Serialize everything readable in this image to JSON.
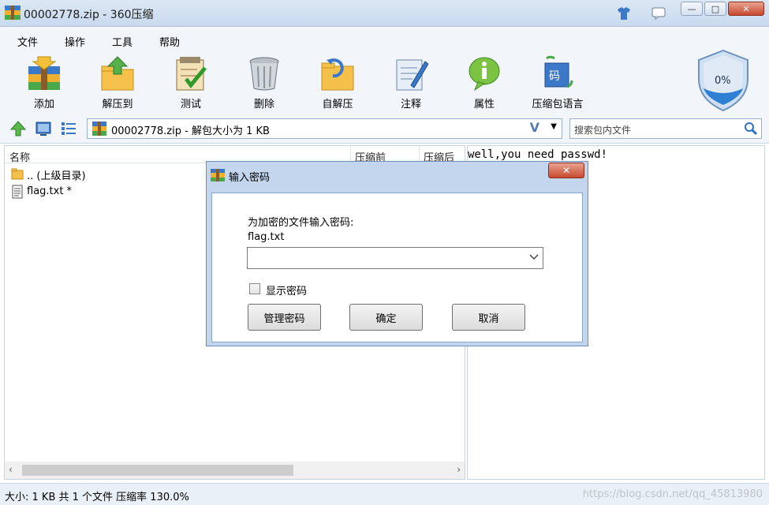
{
  "window": {
    "title": "00002778.zip - 360压缩"
  },
  "menu": [
    "文件",
    "操作",
    "工具",
    "帮助"
  ],
  "toolbar": [
    {
      "label": "添加",
      "icon": "add-archive-icon"
    },
    {
      "label": "解压到",
      "icon": "extract-to-icon"
    },
    {
      "label": "测试",
      "icon": "test-icon"
    },
    {
      "label": "删除",
      "icon": "delete-icon"
    },
    {
      "label": "自解压",
      "icon": "self-extract-icon"
    },
    {
      "label": "注释",
      "icon": "comment-icon"
    },
    {
      "label": "属性",
      "icon": "properties-icon"
    },
    {
      "label": "压缩包语言",
      "icon": "archive-language-icon"
    }
  ],
  "shield": {
    "percent": "0%"
  },
  "address": {
    "path": "00002778.zip - 解包大小为 1 KB"
  },
  "search": {
    "placeholder": "搜索包内文件"
  },
  "filelist": {
    "columns": [
      "名称",
      "压缩前",
      "压缩后"
    ],
    "rows": [
      {
        "name": ".. (上级目录)",
        "type": "folder"
      },
      {
        "name": "flag.txt *",
        "type": "file"
      }
    ]
  },
  "comment": {
    "text": "well,you need passwd!"
  },
  "status": {
    "text": "大小: 1 KB 共 1 个文件 压缩率 130.0%",
    "watermark": "https://blog.csdn.net/qq_45813980"
  },
  "dialog": {
    "title": "输入密码",
    "prompt": "为加密的文件输入密码:",
    "filename": "flag.txt",
    "password_value": "",
    "show_password_label": "显示密码",
    "buttons": {
      "manage": "管理密码",
      "ok": "确定",
      "cancel": "取消"
    }
  },
  "colors": {
    "titlebar": "#c9daee",
    "accent": "#2f6fc2",
    "close": "#c84a30"
  }
}
